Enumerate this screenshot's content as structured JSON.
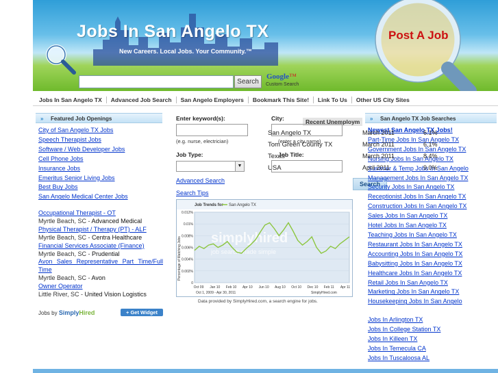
{
  "header": {
    "title": "Jobs In San Angelo TX",
    "tagline": "New Careers.  Local Jobs.  Your Community.™",
    "post_job": "Post A Job",
    "search_button": "Search",
    "google_logo": "Google",
    "custom_search": "Custom Search"
  },
  "nav": {
    "items": [
      "Jobs In San Angelo TX",
      "Advanced Job Search",
      "San Angelo Employers",
      "Bookmark This Site!",
      "Link To Us",
      "Other US City Sites"
    ]
  },
  "left": {
    "heading": "Featured Job Openings",
    "links": [
      "City of San Angelo TX Jobs",
      "Speech Therapist Jobs",
      "Software / Web Developer Jobs",
      "Cell Phone Jobs",
      "Insurance Jobs",
      "Emeritus Senior Living Jobs",
      "Best Buy Jobs",
      "San Angelo Medical Center Jobs"
    ],
    "jobs": [
      {
        "title": "Occupational Therapist - OT",
        "location": "Myrtle Beach, SC",
        "company": "Advanced Medical"
      },
      {
        "title": "Physical Therapist / Therapy (PT) - ALF",
        "location": "Myrtle Beach, SC",
        "company": "Centra Healthcare"
      },
      {
        "title": "Financial Services Associate (Finance)",
        "location": "Myrtle Beach, SC",
        "company": "Prudential"
      },
      {
        "title": "Avon Sales Representative Part Time/Full Time",
        "location": "Myrtle Beach, SC",
        "company": "Avon"
      },
      {
        "title": "Owner Operator",
        "location": "Little River, SC",
        "company": "United Vision Logistics"
      }
    ],
    "jobs_by": "Jobs by",
    "simply": "Simply",
    "hired": "Hired",
    "get_widget": "+ Get Widget"
  },
  "search_form": {
    "keyword_label": "Enter keyword(s):",
    "keyword_hint": "(e.g. nurse, electrician)",
    "city_label": "City:",
    "city_hint": "(enter a city name)",
    "job_type_label": "Job Type:",
    "job_title_label": "Job Title:",
    "advanced_link": "Advanced Job Search",
    "advanced_visible": "Advanced Search",
    "tips_link": "Search Tips",
    "search_button": "Search",
    "unemployment_tab": "Recent Unemploym",
    "unemployment_rows": [
      "San Angelo TX",
      "Tom Green County TX",
      "Texas",
      "USA"
    ],
    "rate_rows": [
      {
        "date": "March 2011",
        "rate": "6.1%"
      },
      {
        "date": "March 2011",
        "rate": "6.1%"
      },
      {
        "date": "March 2011",
        "rate": "8.4%"
      },
      {
        "date": "April 2011",
        "rate": "9.0%"
      }
    ]
  },
  "chart_data": {
    "type": "line",
    "title": "Job Trends for",
    "series": [
      {
        "name": "San Angelo TX",
        "values": [
          0.0055,
          0.0062,
          0.0058,
          0.0064,
          0.0066,
          0.006,
          0.0064,
          0.007,
          0.006,
          0.0052,
          0.005,
          0.0058,
          0.0065,
          0.0073,
          0.0086,
          0.0098,
          0.0102,
          0.0092,
          0.008,
          0.009,
          0.0102,
          0.0088,
          0.0072,
          0.0064,
          0.007,
          0.0078,
          0.006,
          0.005,
          0.0054,
          0.0062,
          0.0058,
          0.0066,
          0.0072,
          0.0078
        ]
      }
    ],
    "x_ticks": [
      "Oct 09",
      "Jan 10",
      "Feb 10",
      "Apr 10",
      "Jun 10",
      "Aug 10",
      "Oct 10",
      "Dec 10",
      "Feb 11",
      "Apr 11"
    ],
    "y_ticks": [
      "0.012%",
      "0.01%",
      "0.008%",
      "0.006%",
      "0.004%",
      "0.002%",
      "0"
    ],
    "ylabel": "Percentage of Matching Jobs",
    "date_range": "Oct 1, 2009 - Apr 30, 2011",
    "watermark": "simplyhired",
    "watermark_sub": "job search made simple",
    "brand": "SimplyHired.com",
    "ylim": [
      0,
      0.012
    ]
  },
  "chart_caption": "Data provided by SimplyHired.com, a search engine for jobs.",
  "right": {
    "heading": "San Angelo TX Job Searches",
    "links": [
      "Newest San Angelo TX Jobs!",
      "Part-Time Jobs In San Angelo TX",
      "Government Jobs In San Angelo TX",
      "Nursing Jobs In San Angelo TX",
      "Summer & Temp Jobs In San Angelo",
      "Management Jobs In San Angelo TX",
      "Security Jobs In San Angelo TX",
      "Receptionist Jobs In San Angelo TX",
      "Construction Jobs In San Angelo TX",
      "Sales Jobs In San Angelo TX",
      "Hotel Jobs In San Angelo TX",
      "Teaching Jobs In San Angelo TX",
      "Restaurant Jobs In San Angelo TX",
      "Accounting Jobs In San Angelo TX",
      "Babysitting Jobs In San Angelo TX",
      "Healthcare Jobs In San Angelo TX",
      "Retail Jobs In San Angelo TX",
      "Marketing Jobs In San Angelo TX",
      "Housekeeping Jobs In San Angelo"
    ],
    "city_links": [
      "Jobs In Arlington TX",
      "Jobs In College Station TX",
      "Jobs In Killeen TX",
      "Jobs In Temecula CA",
      "Jobs In Tuscaloosa AL"
    ]
  },
  "colors": {
    "link": "#0033cc",
    "post_job": "#cc1111",
    "accent": "#2a82c6"
  }
}
